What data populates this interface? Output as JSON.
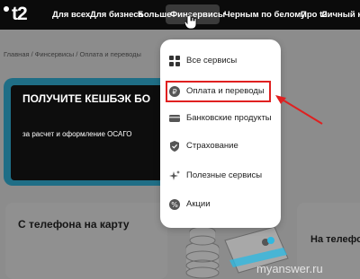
{
  "nav": {
    "logo": "t2",
    "items": [
      "Для всех",
      "Для бизнеса",
      "Больше",
      "Финсервисы",
      "Черным по белому",
      "Про t2",
      "Личный каб"
    ],
    "active_index": 3
  },
  "breadcrumb": "Главная / Финсервисы / Оплата и переводы",
  "promo": {
    "title": "ПОЛУЧИТЕ КЕШБЭК БО",
    "subtitle": "за расчет и оформление ОСАГО"
  },
  "cards": {
    "left_title": "С телефона на карту",
    "right_title": "На телефон"
  },
  "dropdown": {
    "items": [
      {
        "label": "Все сервисы",
        "icon": "grid-icon"
      },
      {
        "label": "Оплата и переводы",
        "icon": "ruble-icon"
      },
      {
        "label": "Банковские продукты",
        "icon": "card-icon"
      },
      {
        "label": "Страхование",
        "icon": "shield-icon"
      },
      {
        "label": "Полезные сервисы",
        "icon": "sparkle-icon"
      },
      {
        "label": "Акции",
        "icon": "percent-icon"
      }
    ],
    "highlighted_index": 1
  },
  "watermark": "myanswer.ru",
  "colors": {
    "nav_bg": "#0b0b0b",
    "accent_border": "#1f6e86",
    "highlight": "#e02020",
    "illustration_accent": "#2fb8e0"
  }
}
